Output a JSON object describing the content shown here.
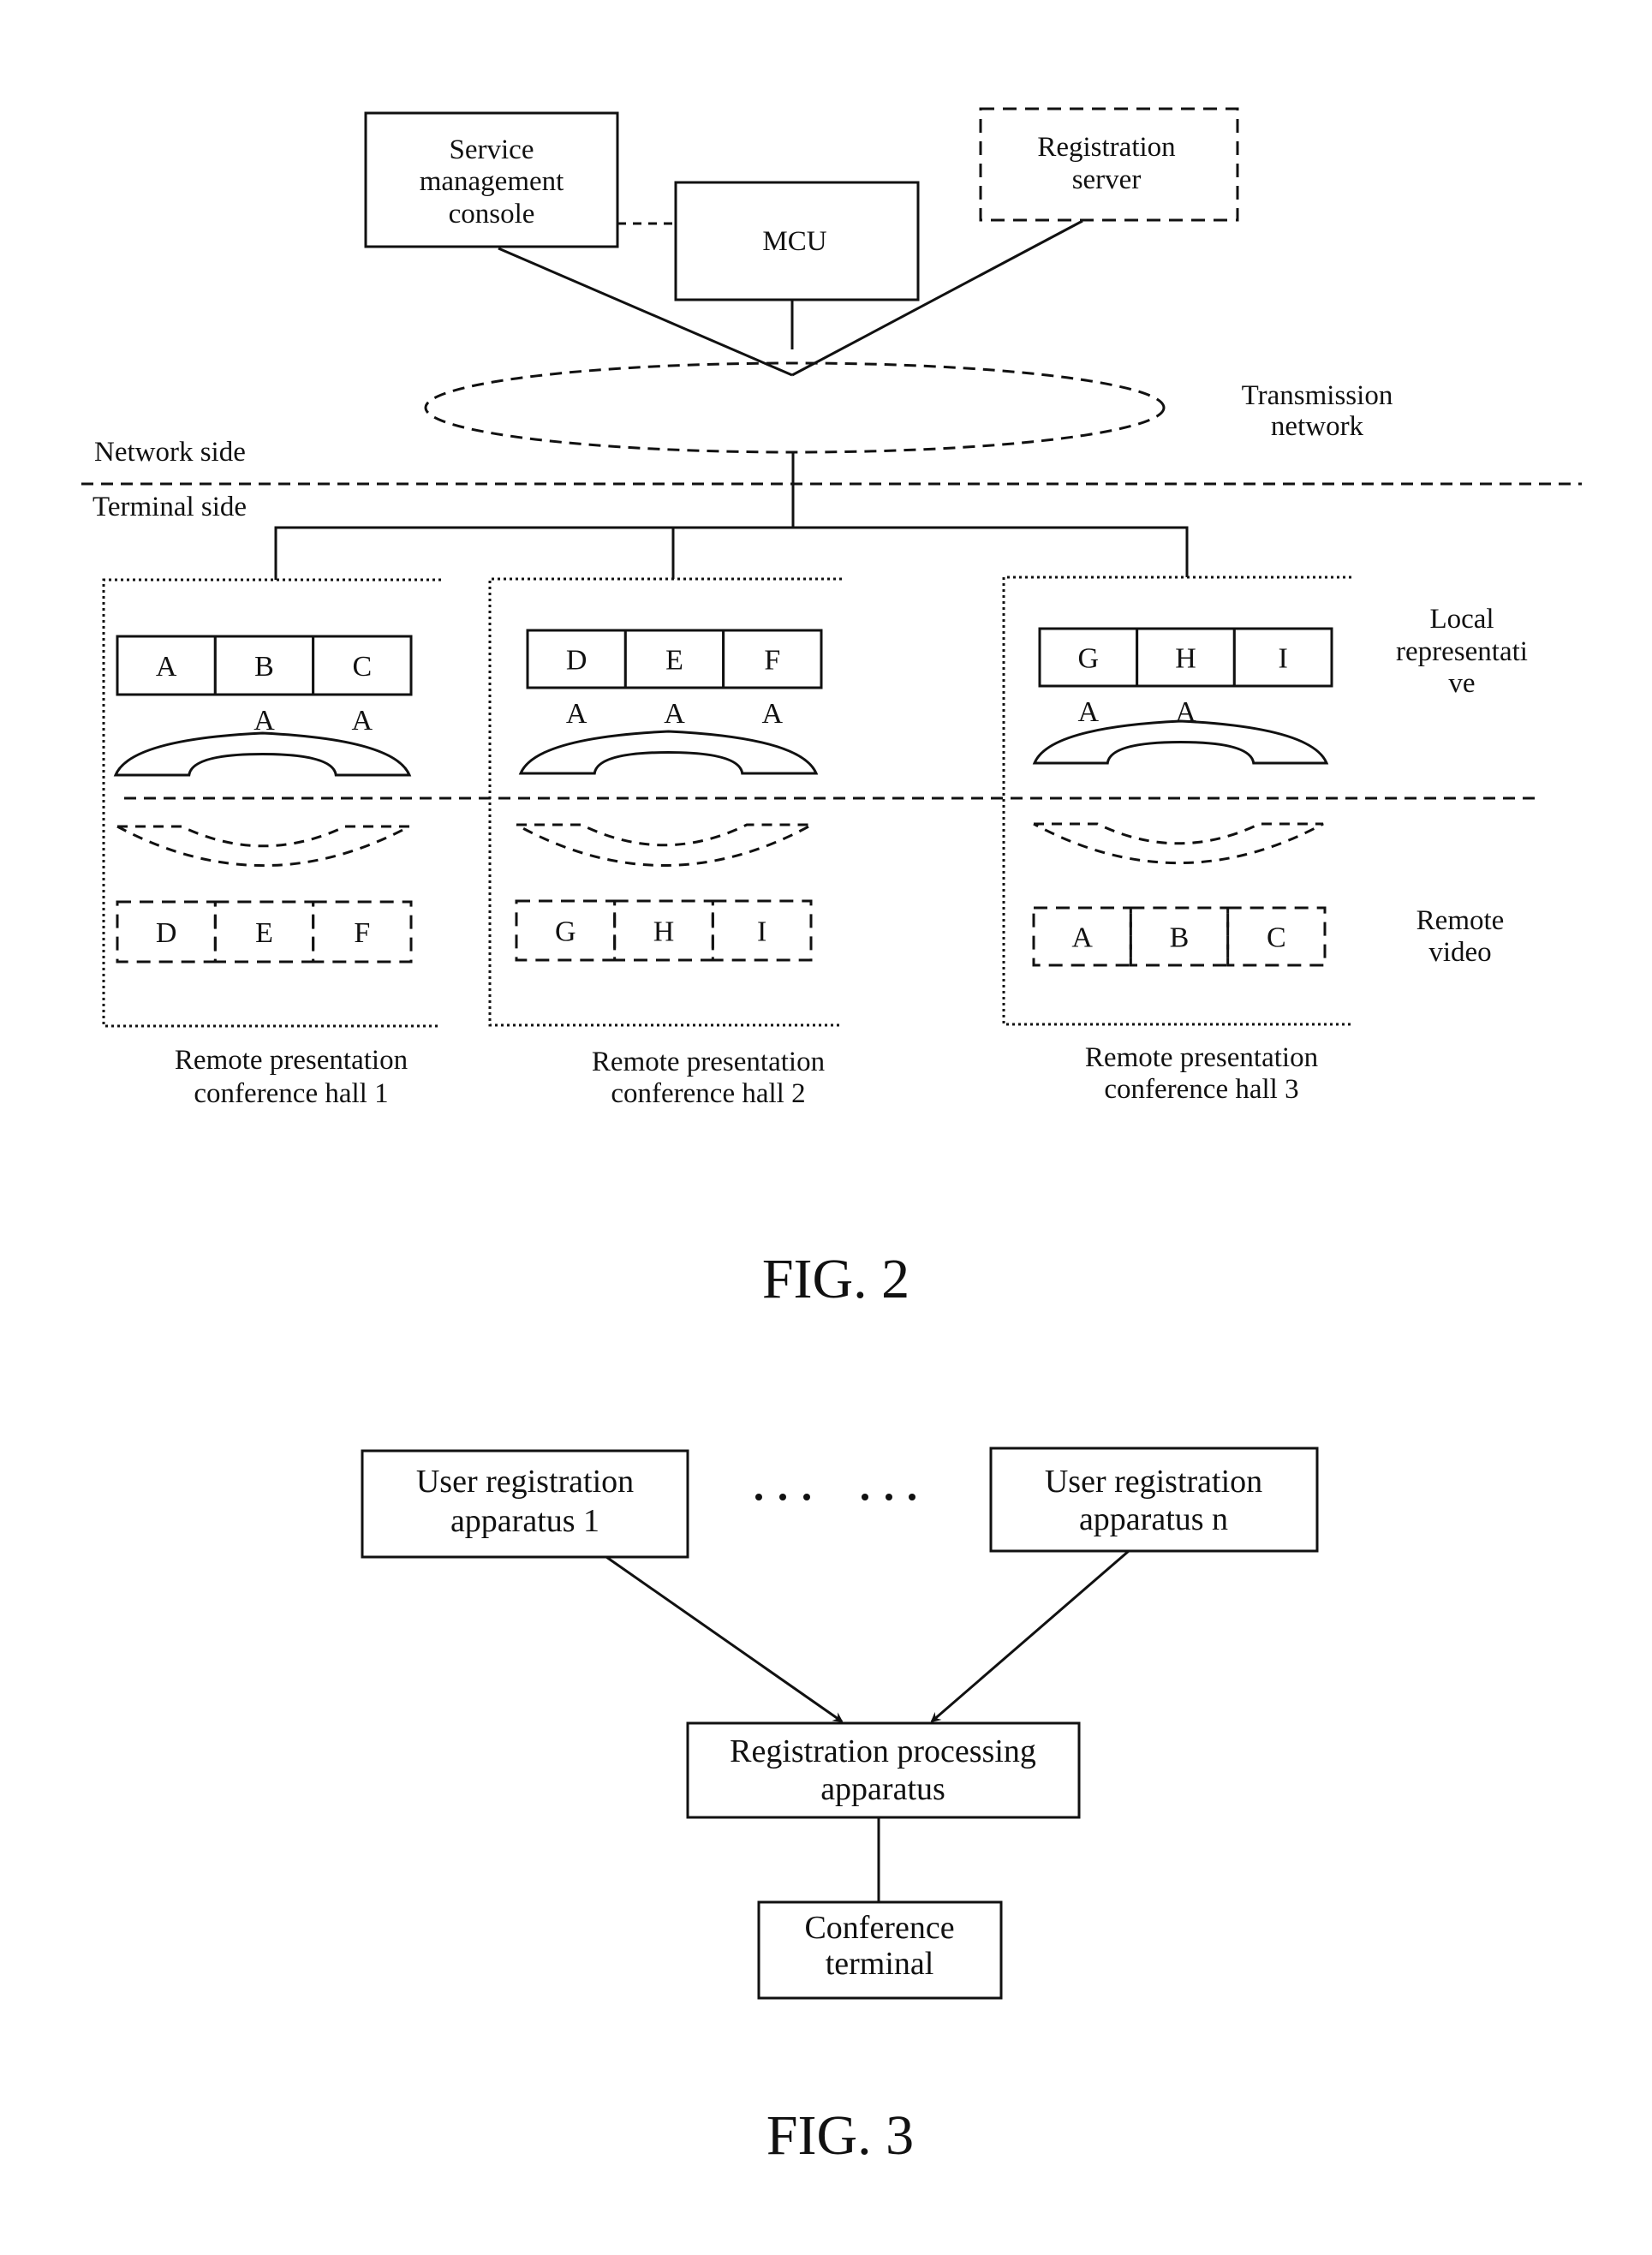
{
  "fig2": {
    "caption": "FIG. 2",
    "service_console": [
      "Service",
      "management",
      "console"
    ],
    "mcu": "MCU",
    "registration_server": [
      "Registration",
      "server"
    ],
    "transmission_network": [
      "Transmission",
      "network"
    ],
    "network_side": "Network side",
    "terminal_side": "Terminal side",
    "local_representative": [
      "Local",
      "representati",
      "ve"
    ],
    "remote_video": [
      "Remote",
      "video"
    ],
    "halls": [
      {
        "label": [
          "Remote presentation",
          "conference hall 1"
        ],
        "local_screens": [
          "A",
          "B",
          "C"
        ],
        "speaker_marks": [
          "",
          "A",
          "A"
        ],
        "remote_screens": [
          "D",
          "E",
          "F"
        ]
      },
      {
        "label": [
          "Remote presentation",
          "conference hall 2"
        ],
        "local_screens": [
          "D",
          "E",
          "F"
        ],
        "speaker_marks": [
          "A",
          "A",
          "A"
        ],
        "remote_screens": [
          "G",
          "H",
          "I"
        ]
      },
      {
        "label": [
          "Remote presentation",
          "conference hall 3"
        ],
        "local_screens": [
          "G",
          "H",
          "I"
        ],
        "speaker_marks": [
          "A",
          "A",
          ""
        ],
        "remote_screens": [
          "A",
          "B",
          "C"
        ]
      }
    ]
  },
  "fig3": {
    "caption": "FIG. 3",
    "user_registration_1": [
      "User registration",
      "apparatus 1"
    ],
    "user_registration_n": [
      "User registration",
      "apparatus n"
    ],
    "ellipsis": "... ...",
    "registration_processing": [
      "Registration processing",
      "apparatus"
    ],
    "conference_terminal": [
      "Conference",
      "terminal"
    ]
  }
}
